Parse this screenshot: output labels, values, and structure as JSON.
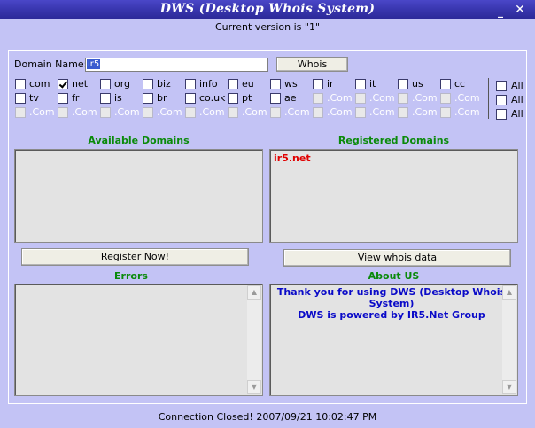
{
  "window": {
    "title": "DWS (Desktop Whois System)",
    "minimize": "_",
    "close": "✕"
  },
  "version_text": "Current version is \"1\"",
  "domain": {
    "label": "Domain Name:",
    "value": "ir5"
  },
  "whois_button": "Whois",
  "tld_rows": [
    {
      "items": [
        {
          "label": "com",
          "checked": false,
          "enabled": true
        },
        {
          "label": "net",
          "checked": true,
          "enabled": true
        },
        {
          "label": "org",
          "checked": false,
          "enabled": true
        },
        {
          "label": "biz",
          "checked": false,
          "enabled": true
        },
        {
          "label": "info",
          "checked": false,
          "enabled": true
        },
        {
          "label": "eu",
          "checked": false,
          "enabled": true
        },
        {
          "label": "ws",
          "checked": false,
          "enabled": true
        },
        {
          "label": "ir",
          "checked": false,
          "enabled": true
        },
        {
          "label": "it",
          "checked": false,
          "enabled": true
        },
        {
          "label": "us",
          "checked": false,
          "enabled": true
        },
        {
          "label": "cc",
          "checked": false,
          "enabled": true
        }
      ]
    },
    {
      "items": [
        {
          "label": "tv",
          "checked": false,
          "enabled": true
        },
        {
          "label": "fr",
          "checked": false,
          "enabled": true
        },
        {
          "label": "is",
          "checked": false,
          "enabled": true
        },
        {
          "label": "br",
          "checked": false,
          "enabled": true
        },
        {
          "label": "co.uk",
          "checked": false,
          "enabled": true
        },
        {
          "label": "pt",
          "checked": false,
          "enabled": true
        },
        {
          "label": "ae",
          "checked": false,
          "enabled": true
        },
        {
          "label": ".Com",
          "checked": false,
          "enabled": false
        },
        {
          "label": ".Com",
          "checked": false,
          "enabled": false
        },
        {
          "label": ".Com",
          "checked": false,
          "enabled": false
        },
        {
          "label": ".Com",
          "checked": false,
          "enabled": false
        }
      ]
    },
    {
      "items": [
        {
          "label": ".Com",
          "checked": false,
          "enabled": false
        },
        {
          "label": ".Com",
          "checked": false,
          "enabled": false
        },
        {
          "label": ".Com",
          "checked": false,
          "enabled": false
        },
        {
          "label": ".Com",
          "checked": false,
          "enabled": false
        },
        {
          "label": ".Com",
          "checked": false,
          "enabled": false
        },
        {
          "label": ".Com",
          "checked": false,
          "enabled": false
        },
        {
          "label": ".Com",
          "checked": false,
          "enabled": false
        },
        {
          "label": ".Com",
          "checked": false,
          "enabled": false
        },
        {
          "label": ".Com",
          "checked": false,
          "enabled": false
        },
        {
          "label": ".Com",
          "checked": false,
          "enabled": false
        },
        {
          "label": ".Com",
          "checked": false,
          "enabled": false
        }
      ]
    }
  ],
  "all_labels": [
    "All",
    "All",
    "All"
  ],
  "available": {
    "title": "Available Domains",
    "items": []
  },
  "registered": {
    "title": "Registered Domains",
    "items": [
      "ir5.net"
    ]
  },
  "register_button": "Register Now!",
  "view_whois_button": "View whois data",
  "errors": {
    "title": "Errors"
  },
  "about": {
    "title": "About US",
    "text": "Thank you for using DWS (Desktop Whois System)\nDWS is powered by IR5.Net Group"
  },
  "status": "Connection Closed! 2007/09/21 10:02:47 PM",
  "colors": {
    "background": "#c3c3f5",
    "title_bar": "#3a37b0",
    "section_title": "#0a8a0a",
    "registered_item": "#e00000",
    "about_text": "#0a0ac8"
  },
  "icons": {
    "minimize": "minimize-icon",
    "close": "close-icon",
    "scroll_up": "scroll-up-arrow-icon",
    "scroll_down": "scroll-down-arrow-icon"
  }
}
